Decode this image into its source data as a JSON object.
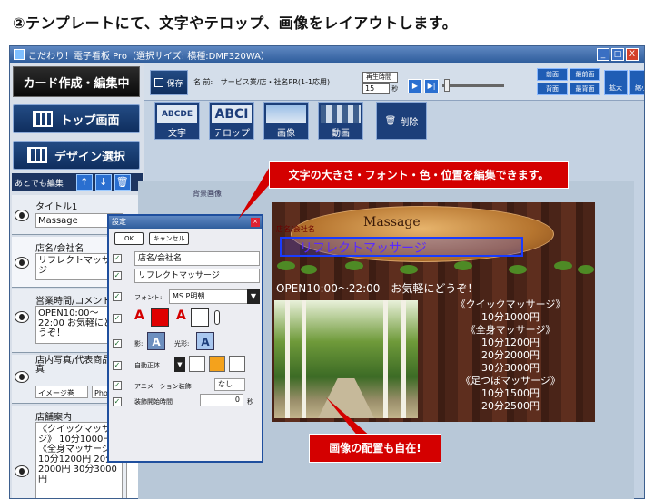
{
  "headline": "②テンプレートにて、文字やテロップ、画像をレイアウトします。",
  "window": {
    "title": "こだわり！電子看板 Pro（選択サイズ: 横種:DMF320WA）",
    "min": "_",
    "max": "□",
    "close": "X"
  },
  "left": {
    "mode_title": "カード作成・編集中",
    "top_screen": "トップ画面",
    "design_select": "デザイン選択",
    "later_edit": "あとでも編集",
    "up": "↑",
    "down": "↓",
    "trash": "🗑",
    "layers": [
      {
        "name": "タイトル1",
        "value": "Massage"
      },
      {
        "name": "店名/会社名",
        "value": "リフレクトマッサージ"
      },
      {
        "name": "営業時間/コメント",
        "value": "OPEN10:00～22:00 お気軽にどうぞ！"
      },
      {
        "name": "店内写真/代表商品写真",
        "value": "イメージ巻",
        "extra": "Photo"
      },
      {
        "name": "店舗案内",
        "value": "《クイックマッサージ》 10分1000円 《全身マッサージ》 10分1200円 20分2000円 30分3000円"
      }
    ]
  },
  "toolbar": {
    "save": "保存",
    "name_label": "名 前:",
    "name_value": "サービス業/店・社名PR(1-1応用)",
    "time_label": "再生時間",
    "time_value": "15",
    "time_unit": "秒",
    "play": "▶",
    "next": "▶|",
    "prev_page": "前面",
    "front_page": "最前面",
    "back_page": "背面",
    "backmost_page": "最背面",
    "zoom_in": "拡大",
    "zoom_out": "縮小"
  },
  "insert": {
    "text": "文字",
    "text_thumb": "ABCDE",
    "telop": "テロップ",
    "telop_thumb": "ABCI",
    "image": "画像",
    "video": "動画",
    "delete": "削除"
  },
  "work": {
    "bg_label": "背景画像",
    "shop_small": "店名/会社名",
    "massage": "Massage",
    "shop_name": "リフレクトマッサージ",
    "hours": "OPEN10:00～22:00　お気軽にどうぞ！",
    "menu": [
      "《クイックマッサージ》",
      "10分1000円",
      "《全身マッサージ》",
      "10分1200円",
      "20分2000円",
      "30分3000円",
      "《足つぼマッサージ》",
      "10分1500円",
      "20分2500円"
    ]
  },
  "dialog": {
    "title": "設定",
    "ok": "OK",
    "cancel": "キャンセル",
    "field1": "店名/会社名",
    "field2": "リフレクトマッサージ",
    "font_label": "フォント:",
    "font_value": "MS P明朝",
    "shadow_label": "影:",
    "glow_label": "光彩:",
    "auto_fit": "自動正体",
    "anim_label": "アニメーション装飾",
    "anim_value": "なし",
    "start_label": "装飾開始時間",
    "start_value": "0",
    "start_unit": "秒"
  },
  "callouts": {
    "edit_text": "文字の大きさ・フォント・色・位置を編集できます。",
    "free_image": "画像の配置も自在!"
  },
  "colors": {
    "accent_red": "#d40000",
    "navy": "#1c3f7a"
  }
}
